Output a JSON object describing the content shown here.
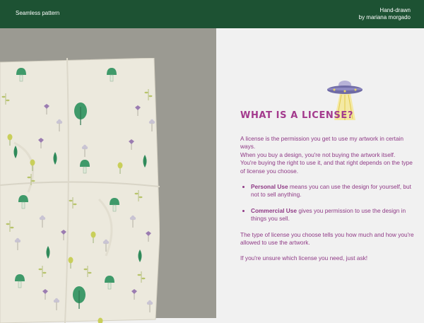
{
  "topbar": {
    "left_title": "Seamless pattern",
    "right_line1": "Hand-drawn",
    "right_line2": "by mariana morgado"
  },
  "icons": {
    "ufo": "ufo-icon",
    "pattern": "botanical-mushroom-pattern"
  },
  "colors": {
    "header_bg": "#1d5233",
    "heading": "#a33a8d",
    "body_text": "#8f3a86",
    "left_panel_bg": "#9b9a92",
    "fabric": "#ece9dd"
  },
  "license": {
    "heading": "WHAT IS A LICENSE?",
    "intro": " A license is the permission you get to use my artwork in certain ways.",
    "buy_line1": "When you buy a design, you're not buying the artwork itself.",
    "buy_line2": "You're buying the right to use it, and that right depends on the type of license you choose.",
    "personal_label": "Personal Use",
    "personal_text": " means you can use the design for yourself, but not to sell anything.",
    "commercial_label": "Commercial Use",
    "commercial_text": " gives you permission to use the design in things you sell.",
    "type_text": "The type of license you choose tells you how much and how you're allowed to use the artwork.",
    "ask_text": "If you're unsure which license you need, just ask!"
  }
}
